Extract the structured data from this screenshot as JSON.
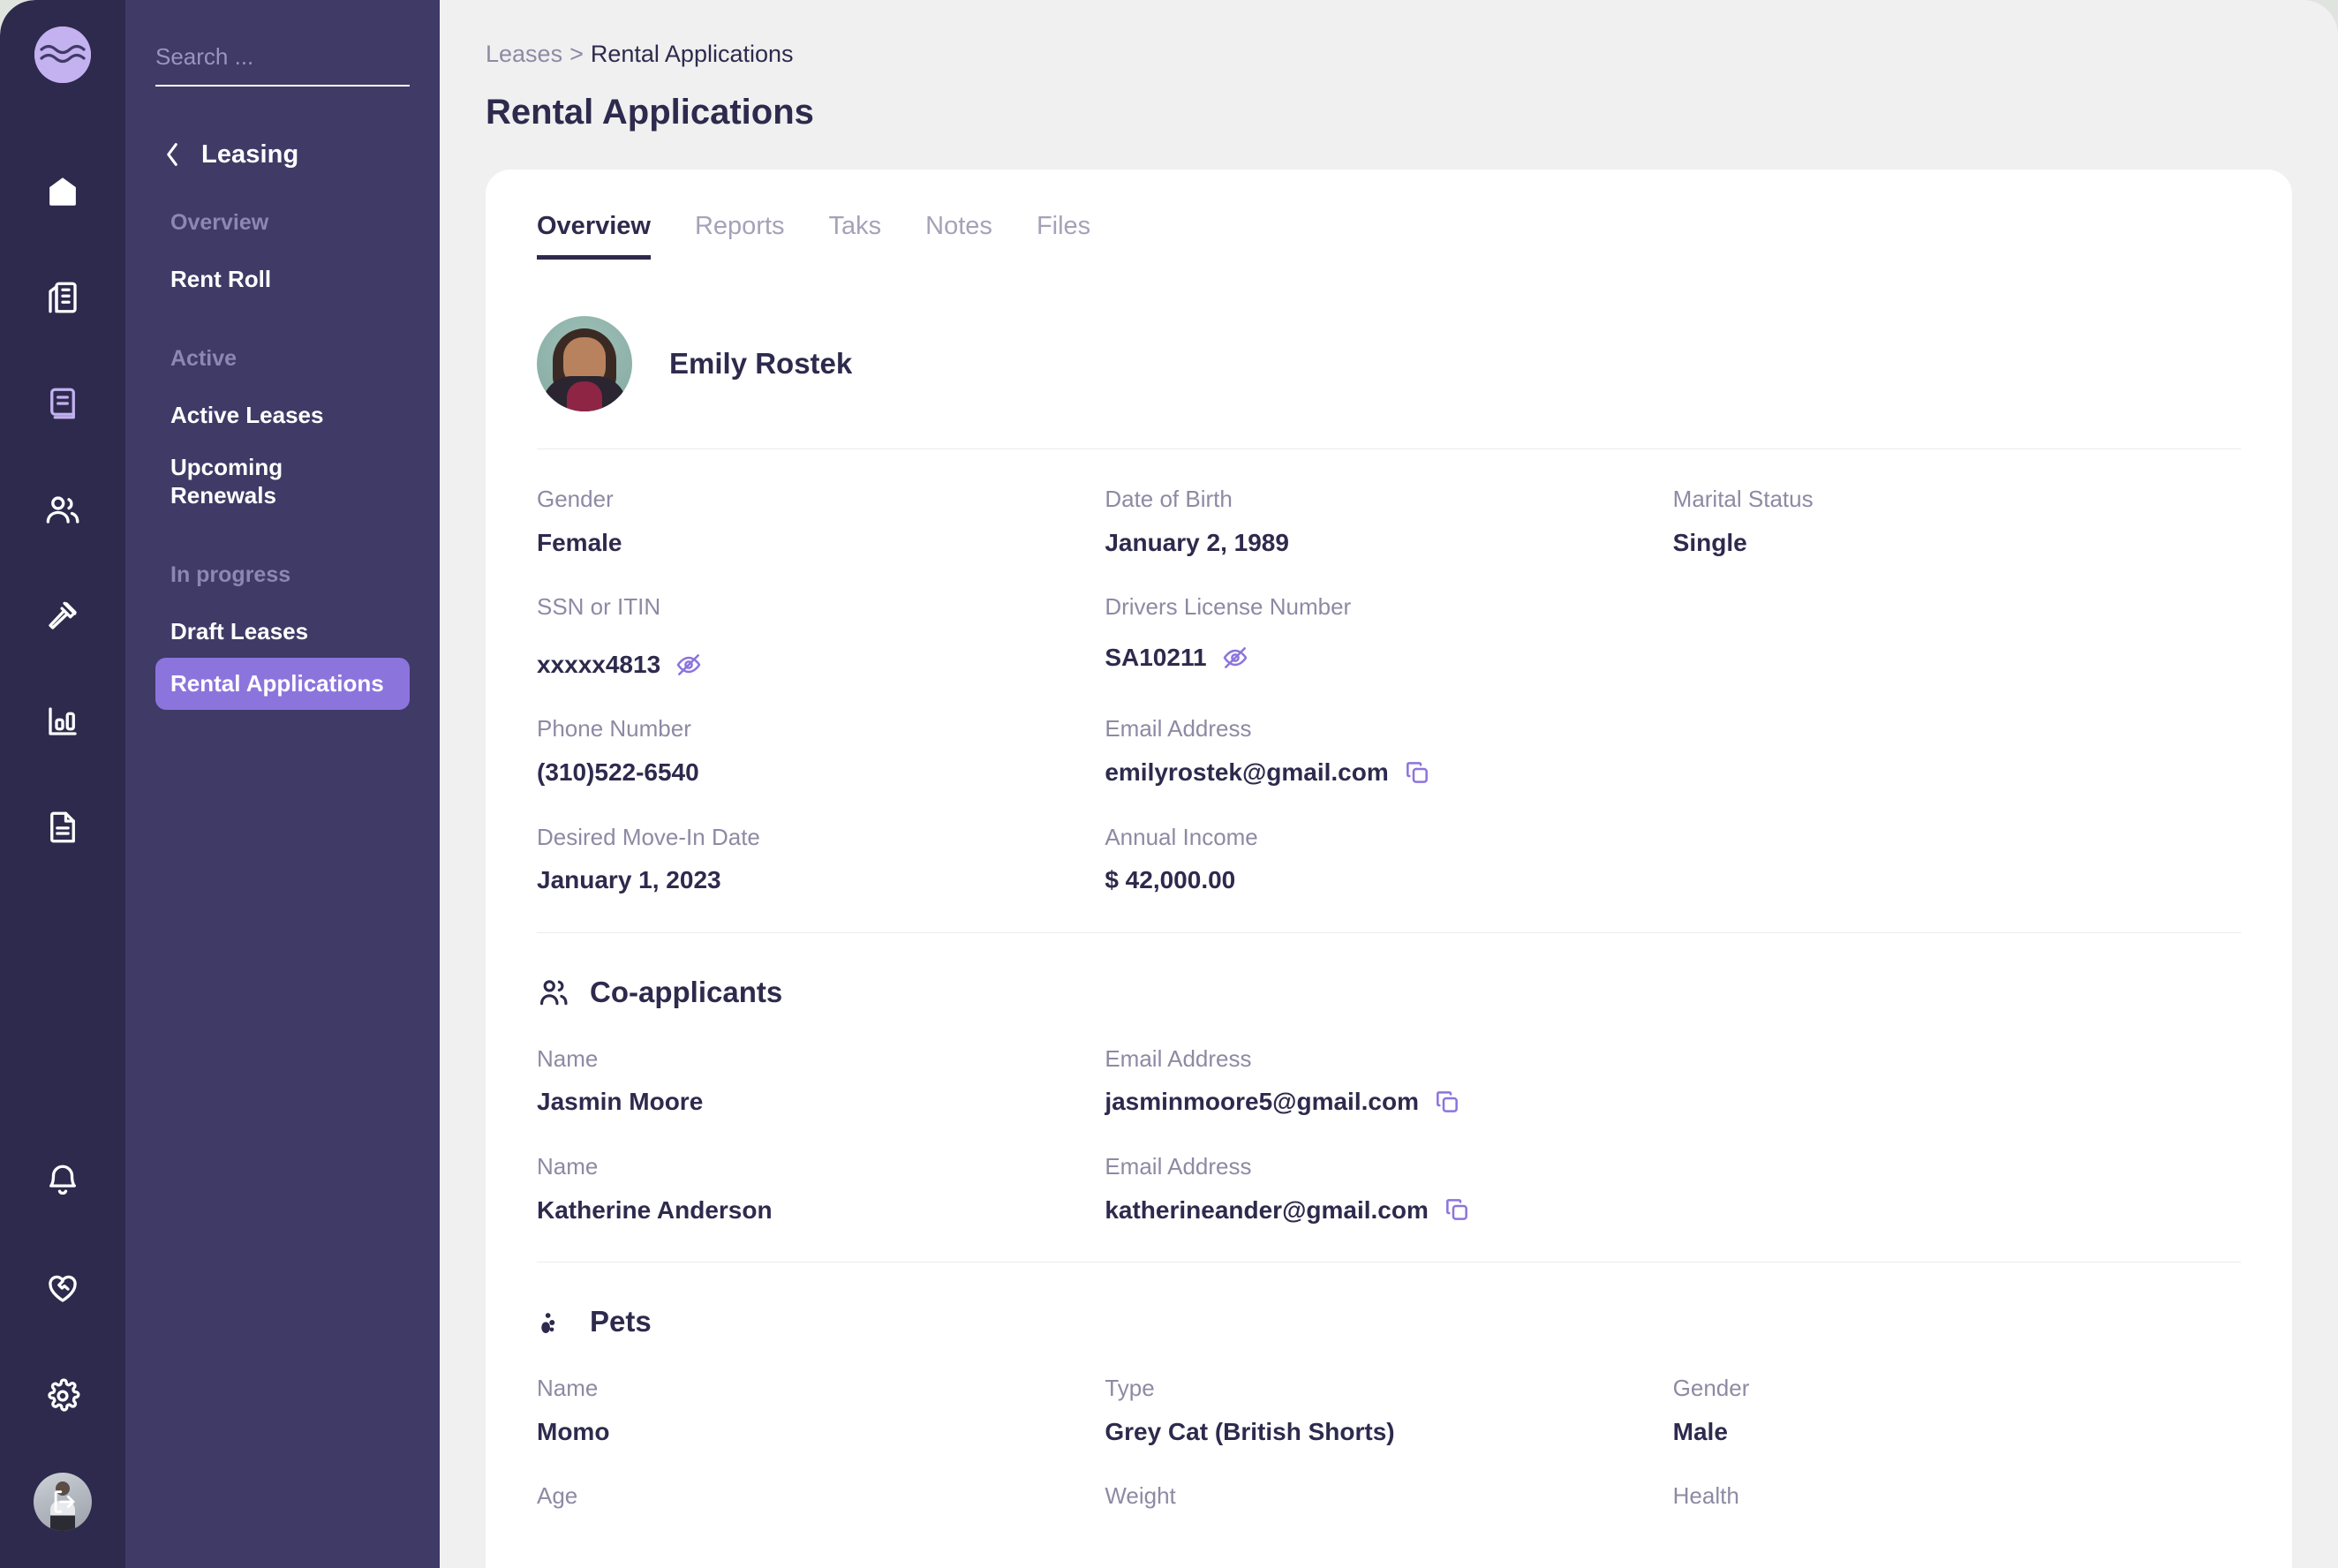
{
  "colors": {
    "rail_bg": "#2e2a4d",
    "sidebar_bg": "#3f3a66",
    "accent_purple": "#8c74dd",
    "page_bg": "#f0f0f0",
    "card_bg": "#ffffff",
    "text_dark": "#2e2a4d",
    "text_muted": "#8d8aa4",
    "icon_purple": "#8c74dd"
  },
  "rail": {
    "logo_name": "wave-logo",
    "items": [
      {
        "icon": "home-icon",
        "label": "Home",
        "active": false
      },
      {
        "icon": "building-icon",
        "label": "Properties",
        "active": false
      },
      {
        "icon": "scroll-lease-icon",
        "label": "Leasing",
        "active": true
      },
      {
        "icon": "people-icon",
        "label": "People",
        "active": false
      },
      {
        "icon": "hammer-icon",
        "label": "Maintenance",
        "active": false
      },
      {
        "icon": "bar-chart-icon",
        "label": "Analytics",
        "active": false
      },
      {
        "icon": "document-icon",
        "label": "Documents",
        "active": false
      }
    ],
    "bottom_items": [
      {
        "icon": "bell-icon",
        "label": "Notifications"
      },
      {
        "icon": "heart-handshake-icon",
        "label": "Support"
      },
      {
        "icon": "gear-icon",
        "label": "Settings"
      }
    ],
    "avatar_name": "user-avatar",
    "avatar_badge_icon": "logout-icon"
  },
  "sidebar": {
    "search": {
      "placeholder": "Search ...",
      "value": "",
      "icon": "search-icon"
    },
    "back": {
      "icon": "chevron-left-icon",
      "label": "Leasing"
    },
    "groups": [
      {
        "title": "Overview",
        "items": [
          {
            "label": "Rent Roll",
            "active": false
          }
        ]
      },
      {
        "title": "Active",
        "items": [
          {
            "label": "Active Leases",
            "active": false
          },
          {
            "label": "Upcoming Renewals",
            "active": false
          }
        ]
      },
      {
        "title": "In progress",
        "items": [
          {
            "label": "Draft Leases",
            "active": false
          },
          {
            "label": "Rental Applications",
            "active": true
          }
        ]
      }
    ]
  },
  "header": {
    "breadcrumb_parent": "Leases",
    "breadcrumb_sep": ">",
    "breadcrumb_current": "Rental Applications",
    "page_title": "Rental Applications"
  },
  "tabs": [
    {
      "label": "Overview",
      "active": true
    },
    {
      "label": "Reports",
      "active": false
    },
    {
      "label": "Taks",
      "active": false
    },
    {
      "label": "Notes",
      "active": false
    },
    {
      "label": "Files",
      "active": false
    }
  ],
  "applicant": {
    "name": "Emily Rostek",
    "avatar_name": "applicant-photo",
    "fields": {
      "gender_label": "Gender",
      "gender_value": "Female",
      "dob_label": "Date of Birth",
      "dob_value": "January 2, 1989",
      "marital_label": "Marital Status",
      "marital_value": "Single",
      "ssn_label": "SSN or ITIN",
      "ssn_value": "xxxxx4813",
      "ssn_toggle_icon": "eye-off-icon",
      "dl_label": "Drivers License Number",
      "dl_value": "SA10211",
      "dl_toggle_icon": "eye-off-icon",
      "phone_label": "Phone Number",
      "phone_value": "(310)522-6540",
      "email_label": "Email Address",
      "email_value": "emilyrostek@gmail.com",
      "email_copy_icon": "copy-icon",
      "movein_label": "Desired Move-In Date",
      "movein_value": "January 1, 2023",
      "income_label": "Annual Income",
      "income_value": "$ 42,000.00"
    }
  },
  "coapplicants": {
    "section_title": "Co-applicants",
    "section_icon": "users-icon",
    "name_label": "Name",
    "email_label": "Email Address",
    "copy_icon": "copy-icon",
    "rows": [
      {
        "name": "Jasmin Moore",
        "email": "jasminmoore5@gmail.com"
      },
      {
        "name": "Katherine Anderson",
        "email": "katherineander@gmail.com"
      }
    ]
  },
  "pets": {
    "section_title": "Pets",
    "section_icon": "paw-icon",
    "name_label": "Name",
    "type_label": "Type",
    "gender_label": "Gender",
    "age_label": "Age",
    "weight_label": "Weight",
    "health_label": "Health",
    "rows": [
      {
        "name": "Momo",
        "type": "Grey Cat (British Shorts)",
        "gender": "Male"
      }
    ]
  }
}
